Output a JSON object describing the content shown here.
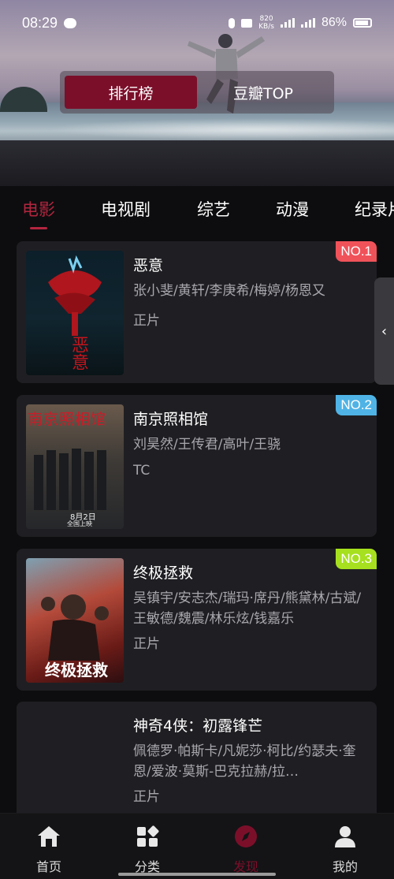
{
  "status": {
    "time": "08:29",
    "net_speed": "820\nKB/s",
    "net_type": "5G HD 5G HD",
    "battery": "86%"
  },
  "segmented": [
    {
      "label": "排行榜",
      "active": true
    },
    {
      "label": "豆瓣TOP",
      "active": false
    }
  ],
  "tabs": [
    "电影",
    "电视剧",
    "综艺",
    "动漫",
    "纪录片"
  ],
  "movies": [
    {
      "rank": "NO.1",
      "rank_color": "#f0525a",
      "title": "恶意",
      "cast": "张小斐/黄轩/李庚希/梅婷/杨恩又",
      "quality": "正片"
    },
    {
      "rank": "NO.2",
      "rank_color": "#4fb3e6",
      "title": "南京照相馆",
      "cast": "刘昊然/王传君/高叶/王骁",
      "quality": "TC"
    },
    {
      "rank": "NO.3",
      "rank_color": "#a6e01e",
      "title": "终极拯救",
      "cast": "吴镇宇/安志杰/瑞玛·席丹/熊黛林/古斌/王敏德/魏震/林乐炫/钱嘉乐",
      "quality": "正片"
    },
    {
      "rank": "",
      "rank_color": "",
      "title": "神奇4侠：初露锋芒",
      "cast": "佩德罗·帕斯卡/凡妮莎·柯比/约瑟夫·奎恩/爱波·莫斯-巴克拉赫/拉…",
      "quality": "正片"
    }
  ],
  "posters": [
    {
      "text": "恶意"
    },
    {
      "text": "南京照相馆",
      "date": "8月2日",
      "sub": "全国上映"
    },
    {
      "text": "终极拯救"
    }
  ],
  "edge_handle_icon": "chevron-left-icon",
  "nav": [
    {
      "label": "首页",
      "icon": "home-icon",
      "active": false
    },
    {
      "label": "分类",
      "icon": "category-icon",
      "active": false
    },
    {
      "label": "发现",
      "icon": "compass-icon",
      "active": true
    },
    {
      "label": "我的",
      "icon": "user-icon",
      "active": false
    }
  ],
  "colors": {
    "accent": "#b2253f",
    "active_nav": "#7b0f2a",
    "card_bg": "#1f1f23"
  }
}
